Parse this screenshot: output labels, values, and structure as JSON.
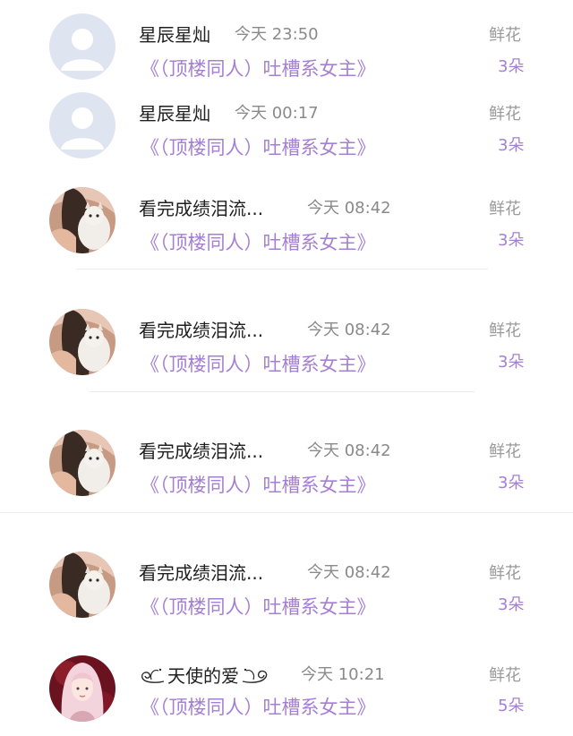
{
  "messages": [
    {
      "avatar_icon": "default-user-avatar-icon",
      "name": "星辰星灿",
      "time": "今天 23:50",
      "book": "《（顶楼同人）吐槽系女主》",
      "gift_name": "鲜花",
      "gift_count": "3朵"
    },
    {
      "avatar_icon": "default-user-avatar-icon",
      "name": "星辰星灿",
      "time": "今天 00:17",
      "book": "《（顶楼同人）吐槽系女主》",
      "gift_name": "鲜花",
      "gift_count": "3朵"
    },
    {
      "avatar_icon": "girl-with-cat-avatar-icon",
      "name": "看完成绩泪流...",
      "time": "今天 08:42",
      "book": "《（顶楼同人）吐槽系女主》",
      "gift_name": "鲜花",
      "gift_count": "3朵"
    },
    {
      "avatar_icon": "girl-with-cat-avatar-icon",
      "name": "看完成绩泪流...",
      "time": "今天 08:42",
      "book": "《（顶楼同人）吐槽系女主》",
      "gift_name": "鲜花",
      "gift_count": "3朵"
    },
    {
      "avatar_icon": "girl-with-cat-avatar-icon",
      "name": "看完成绩泪流...",
      "time": "今天 08:42",
      "book": "《（顶楼同人）吐槽系女主》",
      "gift_name": "鲜花",
      "gift_count": "3朵"
    },
    {
      "avatar_icon": "girl-with-cat-avatar-icon",
      "name": "看完成绩泪流...",
      "time": "今天 08:42",
      "book": "《（顶楼同人）吐槽系女主》",
      "gift_name": "鲜花",
      "gift_count": "3朵"
    },
    {
      "avatar_icon": "anime-girl-avatar-icon",
      "name": "天使的爱",
      "time": "今天 10:21",
      "book": "《（顶楼同人）吐槽系女主》",
      "gift_name": "鲜花",
      "gift_count": "5朵"
    }
  ],
  "colors": {
    "book_title": "#a57fd4",
    "gift_count": "#a57fd4",
    "name": "#1f1f1f",
    "time": "#8a8a8a",
    "gift_name": "#9a9a9a",
    "default_avatar_bg": "#dfe4f1"
  }
}
